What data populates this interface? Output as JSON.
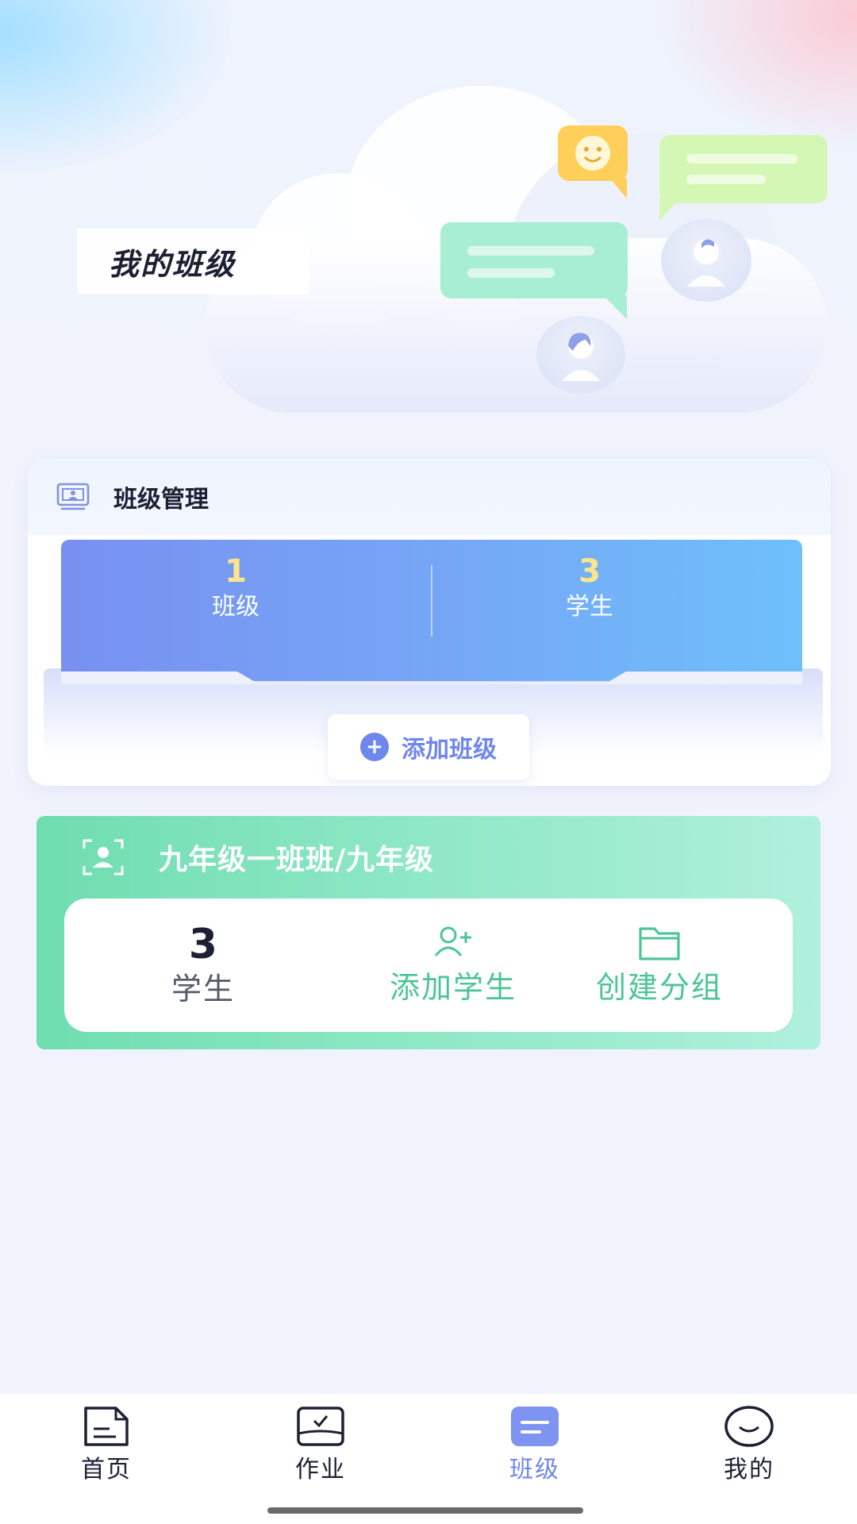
{
  "hero": {
    "title": "我的班级"
  },
  "management": {
    "title": "班级管理",
    "stats": [
      {
        "value": "1",
        "label": "班级"
      },
      {
        "value": "3",
        "label": "学生"
      }
    ],
    "add_button": "添加班级"
  },
  "class_card": {
    "name": "九年级一班班/九年级",
    "student_count": "3",
    "student_label": "学生",
    "add_student": "添加学生",
    "create_group": "创建分组"
  },
  "tabbar": {
    "items": [
      {
        "label": "首页",
        "icon": "home-doc-icon"
      },
      {
        "label": "作业",
        "icon": "homework-icon"
      },
      {
        "label": "班级",
        "icon": "class-icon"
      },
      {
        "label": "我的",
        "icon": "profile-smile-icon"
      }
    ],
    "active": "班级"
  },
  "colors": {
    "accent": "#6f86ec",
    "green": "#4cc596",
    "stat_number": "#ffe58a"
  }
}
